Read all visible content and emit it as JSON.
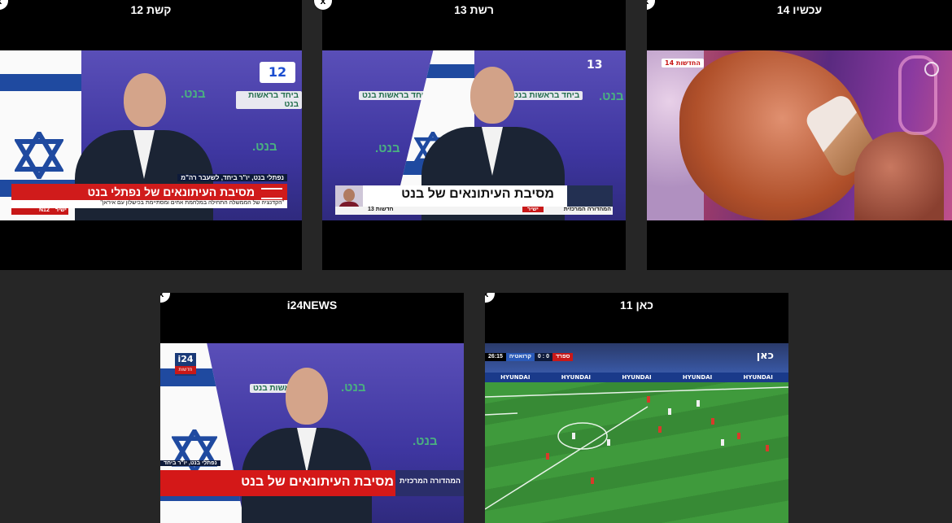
{
  "tiles": [
    {
      "title": "קשת 12",
      "logo": "12",
      "lower_third": {
        "name_line": "נפתלי בנט, יו\"ר ביחד, לשעבר רה\"מ",
        "headline": "מסיבת העיתונאים של נפתלי בנט",
        "quote": "\"הקדנציה של הממשלה התחילה במלחמת אחים ומסתיימת בכישלון עם איראן\"",
        "source": "N12",
        "tag": "ישיר"
      },
      "wall_texts": [
        "ביחד בראשות בנט",
        "בנט.",
        "בנט."
      ]
    },
    {
      "title": "רשת 13",
      "logo": "13",
      "lower_third": {
        "headline": "מסיבת העיתונאים של בנט",
        "sub_label": "המהדורה המרכזית",
        "source": "חדשות 13",
        "tag": "ישיר"
      },
      "wall_texts": [
        "ביחד בראשות בנט",
        "בנט.",
        "ביחד בראשות בנט",
        "בנט."
      ]
    },
    {
      "title": "עכשיו 14",
      "badge": "החדשות 14"
    },
    {
      "title": "i24NEWS",
      "logo": "i24",
      "logo_sub": "חדשות",
      "lower_third": {
        "name_line": "נפתלי בנט, יו\"ר ביחד",
        "headline": "מסיבת העיתונאים של בנט",
        "sub_label": "המהדורה המרכזית"
      },
      "wall_texts": [
        "ביחד בראשות בנט",
        "בנט.",
        "בנט."
      ]
    },
    {
      "title": "כאן 11",
      "logo": "כאן",
      "scoreboard": {
        "time": "26:15",
        "home": "קרואטיה",
        "score": "0 : 0",
        "away": "ספרד"
      },
      "ads": [
        "HYUNDAI",
        "HYUNDAI",
        "HYUNDAI",
        "HYUNDAI",
        "HYUNDAI"
      ]
    }
  ],
  "close_label": "x"
}
